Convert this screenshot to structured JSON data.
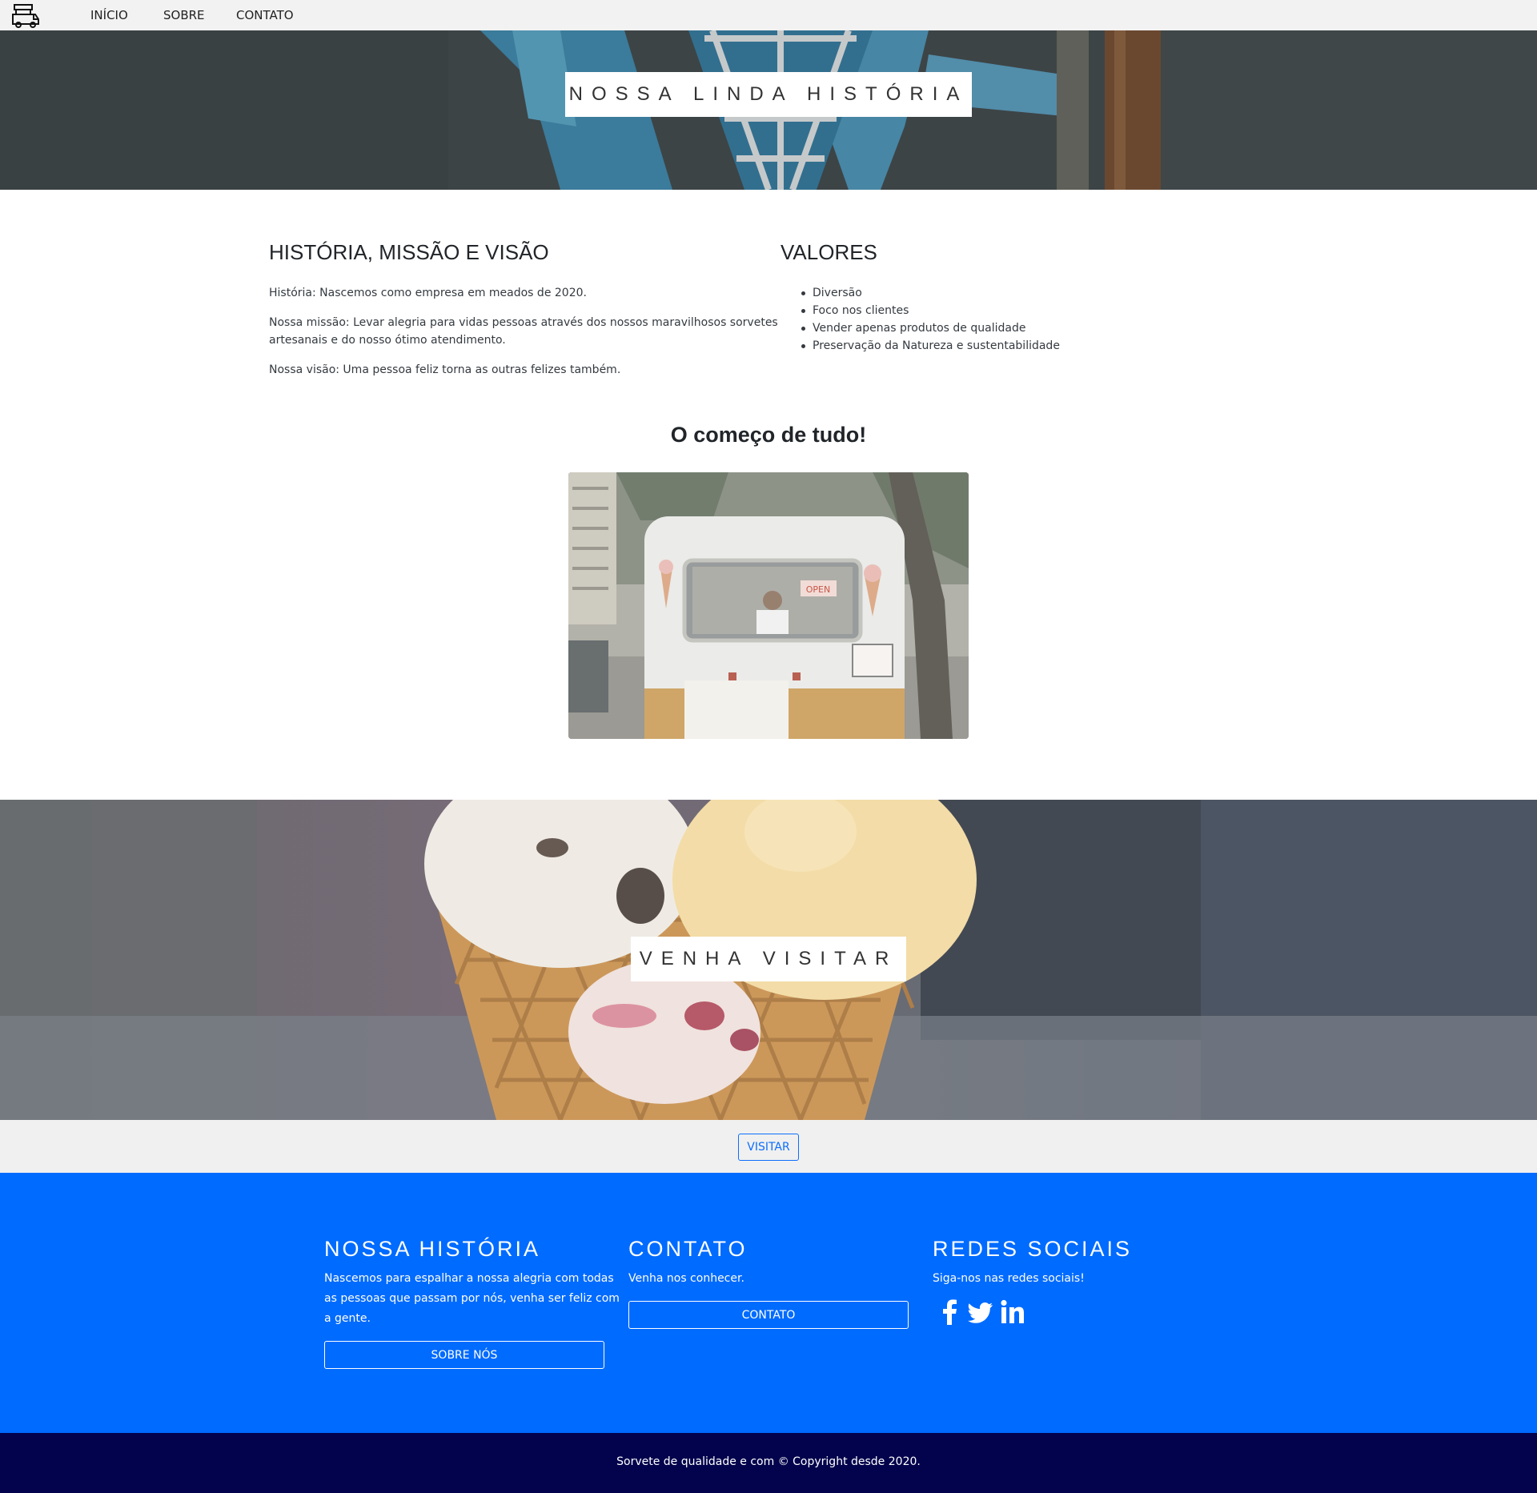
{
  "navbar": {
    "logo_icon": "ice-cream-truck-icon",
    "links": [
      "INÍCIO",
      "SOBRE",
      "CONTATO"
    ]
  },
  "hero": {
    "title": "NOSSA LINDA HISTÓRIA"
  },
  "about": {
    "heading": "HISTÓRIA, MISSÃO E VISÃO",
    "history": "História: Nascemos como empresa em meados de 2020.",
    "mission_line1": "Nossa missão: Levar alegria para vidas pessoas através dos nossos maravilhosos sorvetes",
    "mission_line2": "artesanais e do nosso ótimo atendimento.",
    "vision": "Nossa visão: Uma pessoa feliz torna as outras felizes também."
  },
  "values": {
    "heading": "VALORES",
    "items": [
      "Diversão",
      "Foco nos clientes",
      "Vender apenas produtos de qualidade",
      "Preservação da Natureza e sustentabilidade"
    ]
  },
  "beginning": {
    "heading": "O começo de tudo!",
    "sign_text": "OPEN"
  },
  "visit": {
    "title": "VENHA VISITAR",
    "button_label": "VISITAR"
  },
  "footer": {
    "history": {
      "heading": "NOSSA HISTÓRIA",
      "text_line1": "Nascemos para espalhar a nossa alegria com todas",
      "text_line2": "as pessoas que passam por nós, venha ser feliz com",
      "text_line3": "a gente.",
      "button_label": "SOBRE NÓS"
    },
    "contact": {
      "heading": "CONTATO",
      "text": "Venha nos conhecer.",
      "button_label": "CONTATO"
    },
    "social": {
      "heading": "REDES SOCIAIS",
      "text": "Siga-nos nas redes sociais!",
      "icons": [
        "facebook-icon",
        "twitter-icon",
        "linkedin-icon"
      ]
    },
    "copyright": "Sorvete de qualidade e com © Copyright desde 2020."
  },
  "colors": {
    "accent": "#0d6efd",
    "footer_bg": "#006bff",
    "copyright_bg": "#03034d",
    "navbar_bg": "#f2f2f2"
  }
}
